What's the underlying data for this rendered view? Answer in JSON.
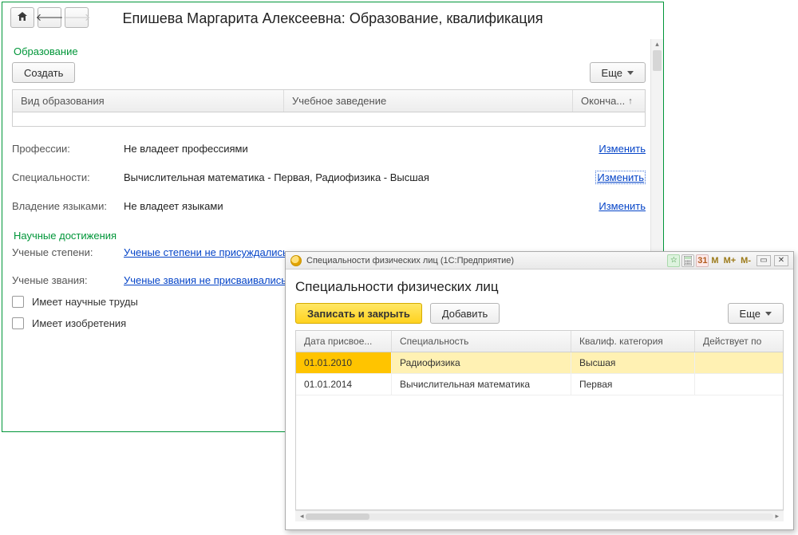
{
  "header": {
    "title": "Епишева Маргарита Алексеевна: Образование, квалификация"
  },
  "education": {
    "section_title": "Образование",
    "create_label": "Создать",
    "more_label": "Еще",
    "columns": {
      "type": "Вид образования",
      "institution": "Учебное заведение",
      "end": "Оконча..."
    }
  },
  "fields": {
    "professions_label": "Профессии:",
    "professions_value": "Не владеет профессиями",
    "professions_change": "Изменить",
    "specialties_label": "Специальности:",
    "specialties_value": "Вычислительная математика - Первая, Радиофизика - Высшая",
    "specialties_change": "Изменить",
    "languages_label": "Владение языками:",
    "languages_value": "Не владеет языками",
    "languages_change": "Изменить"
  },
  "achievements": {
    "section_title": "Научные достижения",
    "degrees_label": "Ученые степени:",
    "degrees_link": "Ученые степени не присуждались",
    "ranks_label": "Ученые звания:",
    "ranks_link": "Ученые звания не присваивались",
    "has_works_label": "Имеет научные труды",
    "has_inventions_label": "Имеет изобретения"
  },
  "dialog": {
    "titlebar": "Специальности физических лиц  (1С:Предприятие)",
    "toolbar": {
      "m": "M",
      "mplus": "M+",
      "mminus": "M-",
      "cal": "31"
    },
    "heading": "Специальности физических лиц",
    "save_close_label": "Записать и закрыть",
    "add_label": "Добавить",
    "more_label": "Еще",
    "columns": {
      "date": "Дата присвое...",
      "spec": "Специальность",
      "cat": "Квалиф. категория",
      "until": "Действует по"
    },
    "rows": [
      {
        "date": "01.01.2010",
        "spec": "Радиофизика",
        "cat": "Высшая",
        "until": ""
      },
      {
        "date": "01.01.2014",
        "spec": "Вычислительная математика",
        "cat": "Первая",
        "until": ""
      }
    ]
  }
}
